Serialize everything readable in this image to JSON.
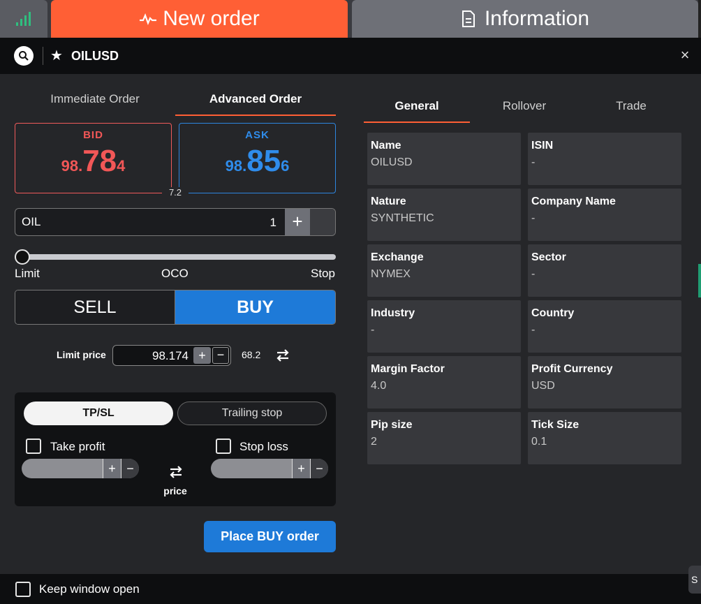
{
  "tabs": {
    "new_order": "New order",
    "information": "Information"
  },
  "header": {
    "symbol": "OILUSD",
    "close": "×"
  },
  "order_tabs": [
    "Immediate Order",
    "Advanced Order"
  ],
  "bid": {
    "label": "BID",
    "pre": "98.",
    "big": "78",
    "post": "4"
  },
  "ask": {
    "label": "ASK",
    "pre": "98.",
    "big": "85",
    "post": "6"
  },
  "spread": "7.2",
  "quantity": {
    "instrument": "OIL",
    "value": "1",
    "plus": "+"
  },
  "slider": {
    "labels": [
      "Limit",
      "OCO",
      "Stop"
    ],
    "position": 0
  },
  "side": {
    "sell": "SELL",
    "buy": "BUY",
    "selected": "BUY"
  },
  "limit": {
    "label": "Limit price",
    "value": "98.174",
    "plus": "+",
    "minus": "−",
    "pips": "68.2"
  },
  "tpsl": {
    "tabs": [
      "TP/SL",
      "Trailing stop"
    ],
    "take_profit": "Take profit",
    "stop_loss": "Stop loss",
    "price_label": "price",
    "plus": "+",
    "minus": "−"
  },
  "place_button": "Place BUY order",
  "info_tabs": [
    "General",
    "Rollover",
    "Trade"
  ],
  "info": [
    {
      "label": "Name",
      "value": "OILUSD"
    },
    {
      "label": "ISIN",
      "value": "-"
    },
    {
      "label": "Nature",
      "value": "SYNTHETIC"
    },
    {
      "label": "Company Name",
      "value": "-"
    },
    {
      "label": "Exchange",
      "value": "NYMEX"
    },
    {
      "label": "Sector",
      "value": "-"
    },
    {
      "label": "Industry",
      "value": "-"
    },
    {
      "label": "Country",
      "value": "-"
    },
    {
      "label": "Margin Factor",
      "value": "4.0"
    },
    {
      "label": "Profit Currency",
      "value": "USD"
    },
    {
      "label": "Pip size",
      "value": "2"
    },
    {
      "label": "Tick Size",
      "value": "0.1"
    }
  ],
  "footer": {
    "keep_open": "Keep window open",
    "edge": "S"
  },
  "colors": {
    "accent": "#ff5f35",
    "bid": "#f25757",
    "ask": "#2f8ceb",
    "buy": "#1e7ad8"
  }
}
